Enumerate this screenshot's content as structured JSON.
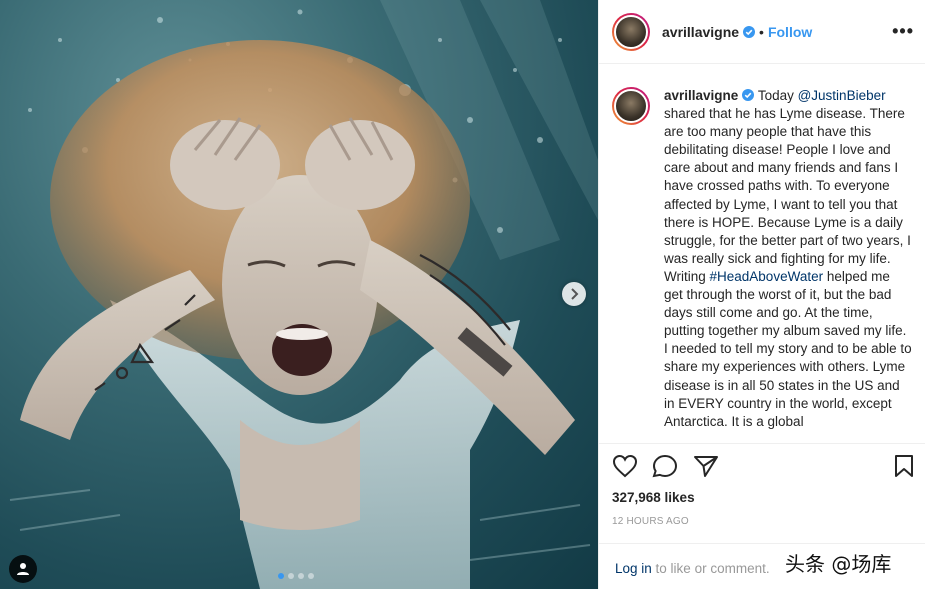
{
  "photo": {
    "carousel": {
      "count": 4,
      "active_index": 0
    }
  },
  "header": {
    "username": "avrillavigne",
    "separator": "•",
    "follow_label": "Follow",
    "more_label": "•••"
  },
  "caption": {
    "username": "avrillavigne",
    "segments": [
      {
        "text": "Today ",
        "type": "text"
      },
      {
        "text": "@JustinBieber",
        "type": "link"
      },
      {
        "text": " shared that he has Lyme disease. There are too many people that have this debilitating disease! People I love and care about and many friends and fans I have crossed paths with. To everyone affected by Lyme, I want to tell you that there is HOPE. Because Lyme is a daily struggle, for the better part of two years, I was really sick and fighting for my life. Writing ",
        "type": "text"
      },
      {
        "text": "#HeadAboveWater",
        "type": "link"
      },
      {
        "text": " helped me get through the worst of it, but the bad days still come and go. At the time, putting together my album saved my life. I needed to tell my story and to be able to share my experiences with others. Lyme disease is in all 50 states in the US and in EVERY country in the world, except Antarctica. It is a global",
        "type": "text"
      }
    ]
  },
  "stats": {
    "likes": "327,968 likes",
    "time": "12 HOURS AGO"
  },
  "footer": {
    "login_link": "Log in",
    "login_rest": " to like or comment.",
    "watermark": "头条 @场库"
  },
  "colors": {
    "accent": "#3897f0",
    "link": "#003569",
    "muted": "#999999",
    "verified": "#3897f0"
  }
}
